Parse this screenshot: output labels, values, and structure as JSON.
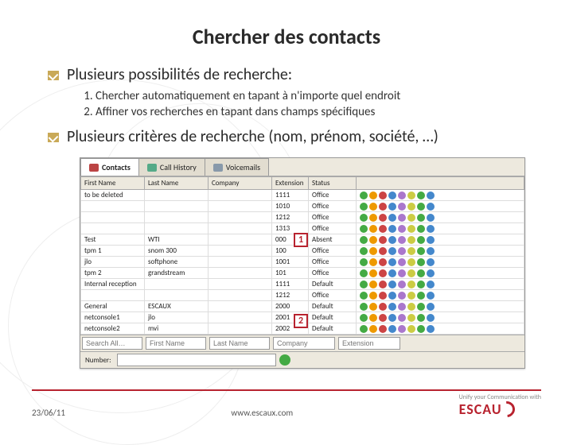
{
  "title": "Chercher des contacts",
  "bullets": {
    "main1": "Plusieurs possibilités de recherche:",
    "sub1": "Chercher automatiquement en tapant à n'importe quel endroit",
    "sub2": "Affiner vos recherches en tapant dans champs spécifiques",
    "main2": "Plusieurs critères de recherche (nom, prénom, société, …)"
  },
  "screenshot": {
    "tabs": {
      "t1": "Contacts",
      "t2": "Call History",
      "t3": "Voicemails"
    },
    "headers": {
      "first": "First Name",
      "last": "Last Name",
      "company": "Company",
      "ext": "Extension",
      "status": "Status",
      "actions": ""
    },
    "search": {
      "all": "Search All…",
      "first": "First Name",
      "last": "Last Name",
      "company": "Company",
      "ext": "Extension"
    },
    "numrow": {
      "label": "Number:"
    },
    "callouts": {
      "c1": "1",
      "c2": "2"
    },
    "rows": [
      {
        "f": "to be deleted",
        "l": "",
        "c": "",
        "e": "1111",
        "s": "Office"
      },
      {
        "f": "",
        "l": "",
        "c": "",
        "e": "1010",
        "s": "Office"
      },
      {
        "f": "",
        "l": "",
        "c": "",
        "e": "1212",
        "s": "Office"
      },
      {
        "f": "",
        "l": "",
        "c": "",
        "e": "1313",
        "s": "Office"
      },
      {
        "f": "Test",
        "l": "WTI",
        "c": "",
        "e": "000",
        "s": "Absent"
      },
      {
        "f": "tpm 1",
        "l": "snom 300",
        "c": "",
        "e": "100",
        "s": "Office"
      },
      {
        "f": "jlo",
        "l": "softphone",
        "c": "",
        "e": "1001",
        "s": "Office"
      },
      {
        "f": "tpm 2",
        "l": "grandstream",
        "c": "",
        "e": "101",
        "s": "Office"
      },
      {
        "f": "Internal reception",
        "l": "",
        "c": "",
        "e": "1111",
        "s": "Default"
      },
      {
        "f": "",
        "l": "",
        "c": "",
        "e": "1212",
        "s": "Office"
      },
      {
        "f": "General",
        "l": "ESCAUX",
        "c": "",
        "e": "2000",
        "s": "Default"
      },
      {
        "f": "netconsole1",
        "l": "jlo",
        "c": "",
        "e": "2001",
        "s": "Default"
      },
      {
        "f": "netconsole2",
        "l": "mvi",
        "c": "",
        "e": "2002",
        "s": "Default"
      }
    ]
  },
  "footer": {
    "date": "23/06/11",
    "url": "www.escaux.com",
    "logo_tag": "Unify your Communication with",
    "logo_brand": "ESCAU"
  }
}
